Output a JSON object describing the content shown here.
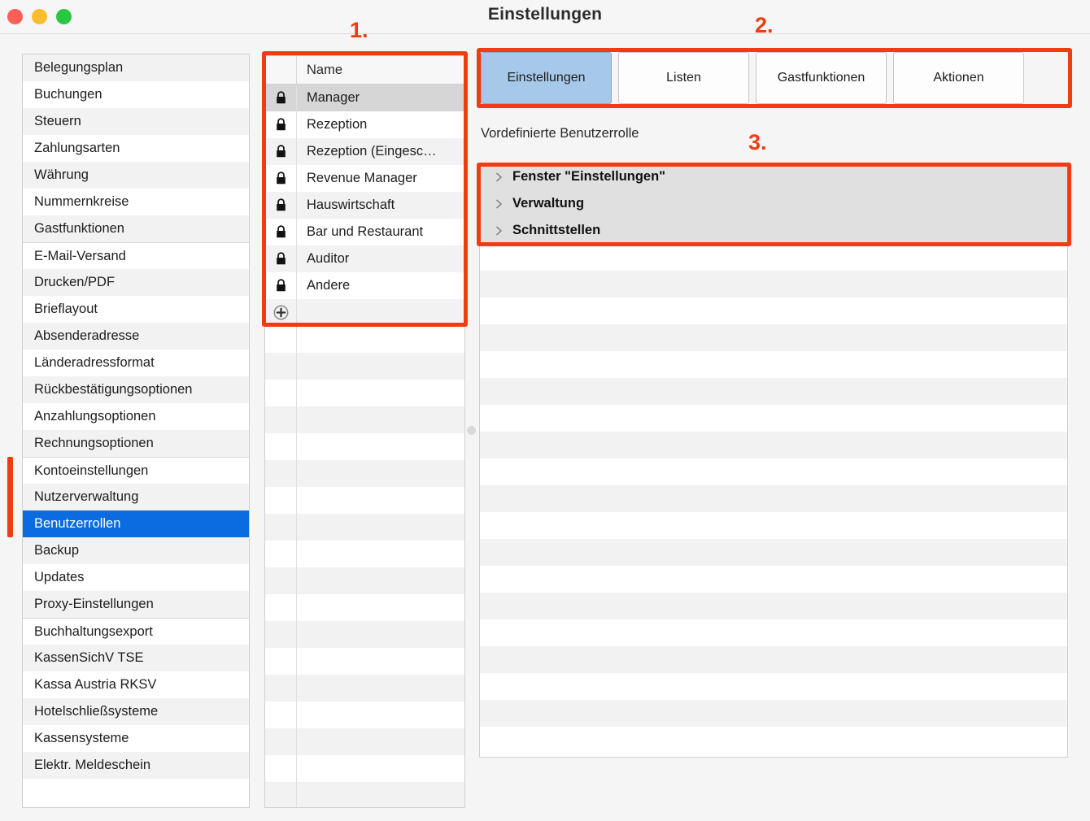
{
  "window": {
    "title": "Einstellungen",
    "traffic_lights": [
      "close-button",
      "minimize-button",
      "maximize-button"
    ]
  },
  "colors": {
    "accent_selection": "#0a6ce0",
    "tab_active": "#a6c9ea",
    "annotation_red": "#f03c12",
    "row_stripe": "#f2f2f2",
    "tree_row": "#e0e0e0"
  },
  "sidebar": {
    "items": [
      {
        "label": "Belegungsplan",
        "selected": false,
        "separator_above": false
      },
      {
        "label": "Buchungen",
        "selected": false,
        "separator_above": false
      },
      {
        "label": "Steuern",
        "selected": false,
        "separator_above": false
      },
      {
        "label": "Zahlungsarten",
        "selected": false,
        "separator_above": false
      },
      {
        "label": "Währung",
        "selected": false,
        "separator_above": false
      },
      {
        "label": "Nummernkreise",
        "selected": false,
        "separator_above": false
      },
      {
        "label": "Gastfunktionen",
        "selected": false,
        "separator_above": false
      },
      {
        "label": "E-Mail-Versand",
        "selected": false,
        "separator_above": true
      },
      {
        "label": "Drucken/PDF",
        "selected": false,
        "separator_above": false
      },
      {
        "label": "Brieflayout",
        "selected": false,
        "separator_above": false
      },
      {
        "label": "Absenderadresse",
        "selected": false,
        "separator_above": false
      },
      {
        "label": "Länderadressformat",
        "selected": false,
        "separator_above": false
      },
      {
        "label": "Rückbestätigungsoptionen",
        "selected": false,
        "separator_above": false
      },
      {
        "label": "Anzahlungsoptionen",
        "selected": false,
        "separator_above": false
      },
      {
        "label": "Rechnungsoptionen",
        "selected": false,
        "separator_above": false
      },
      {
        "label": "Kontoeinstellungen",
        "selected": false,
        "separator_above": true
      },
      {
        "label": "Nutzerverwaltung",
        "selected": false,
        "separator_above": false
      },
      {
        "label": "Benutzerrollen",
        "selected": true,
        "separator_above": false
      },
      {
        "label": "Backup",
        "selected": false,
        "separator_above": false
      },
      {
        "label": "Updates",
        "selected": false,
        "separator_above": false
      },
      {
        "label": "Proxy-Einstellungen",
        "selected": false,
        "separator_above": false
      },
      {
        "label": "Buchhaltungsexport",
        "selected": false,
        "separator_above": true
      },
      {
        "label": "KassenSichV TSE",
        "selected": false,
        "separator_above": false
      },
      {
        "label": "Kassa Austria RKSV",
        "selected": false,
        "separator_above": false
      },
      {
        "label": "Hotelschließsysteme",
        "selected": false,
        "separator_above": false
      },
      {
        "label": "Kassensysteme",
        "selected": false,
        "separator_above": false
      },
      {
        "label": "Elektr. Meldeschein",
        "selected": false,
        "separator_above": false
      }
    ]
  },
  "roles_table": {
    "header": {
      "lock_column": "",
      "name_column": "Name"
    },
    "rows": [
      {
        "name": "Manager",
        "locked": true,
        "selected": true
      },
      {
        "name": "Rezeption",
        "locked": true,
        "selected": false
      },
      {
        "name": "Rezeption (Eingesc…",
        "locked": true,
        "selected": false
      },
      {
        "name": "Revenue Manager",
        "locked": true,
        "selected": false
      },
      {
        "name": "Hauswirtschaft",
        "locked": true,
        "selected": false
      },
      {
        "name": "Bar und Restaurant",
        "locked": true,
        "selected": false
      },
      {
        "name": "Auditor",
        "locked": true,
        "selected": false
      },
      {
        "name": "Andere",
        "locked": true,
        "selected": false
      }
    ],
    "add_button": "add-role-button",
    "empty_row_count": 18
  },
  "tabs": [
    {
      "label": "Einstellungen",
      "active": true
    },
    {
      "label": "Listen",
      "active": false
    },
    {
      "label": "Gastfunktionen",
      "active": false
    },
    {
      "label": "Aktionen",
      "active": false
    }
  ],
  "right_pane": {
    "section_label": "Vordefinierte Benutzerrolle",
    "tree_rows": [
      {
        "label": "Fenster \"Einstellungen\"",
        "expanded": false
      },
      {
        "label": "Verwaltung",
        "expanded": false
      },
      {
        "label": "Schnittstellen",
        "expanded": false
      }
    ],
    "empty_row_count": 19
  },
  "annotations": [
    {
      "number": "1.",
      "target": "roles-table"
    },
    {
      "number": "2.",
      "target": "tab-bar"
    },
    {
      "number": "3.",
      "target": "permission-tree"
    }
  ]
}
